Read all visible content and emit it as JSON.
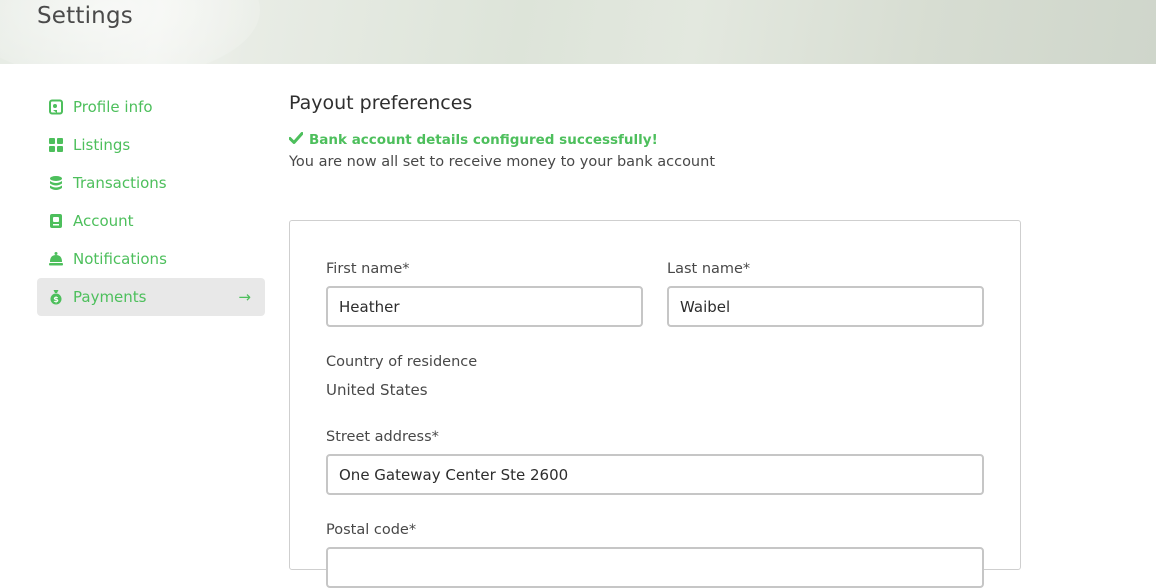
{
  "header": {
    "title": "Settings"
  },
  "sidebar": {
    "items": [
      {
        "label": "Profile info",
        "icon": "profile-icon"
      },
      {
        "label": "Listings",
        "icon": "grid-icon"
      },
      {
        "label": "Transactions",
        "icon": "stack-icon"
      },
      {
        "label": "Account",
        "icon": "account-icon"
      },
      {
        "label": "Notifications",
        "icon": "bell-icon"
      },
      {
        "label": "Payments",
        "icon": "money-bag-icon",
        "active": true
      }
    ],
    "active_arrow": "→"
  },
  "main": {
    "title": "Payout preferences",
    "success_message": "Bank account details configured successfully!",
    "success_sub": "You are now all set to receive money to your bank account"
  },
  "form": {
    "first_name": {
      "label": "First name*",
      "value": "Heather"
    },
    "last_name": {
      "label": "Last name*",
      "value": "Waibel"
    },
    "country": {
      "label": "Country of residence",
      "value": "United States"
    },
    "street": {
      "label": "Street address*",
      "value": "One Gateway Center Ste 2600"
    },
    "postal": {
      "label": "Postal code*",
      "value": ""
    }
  },
  "colors": {
    "accent": "#4dbf5c",
    "text": "#484848",
    "active_bg": "#e8e8e8"
  }
}
